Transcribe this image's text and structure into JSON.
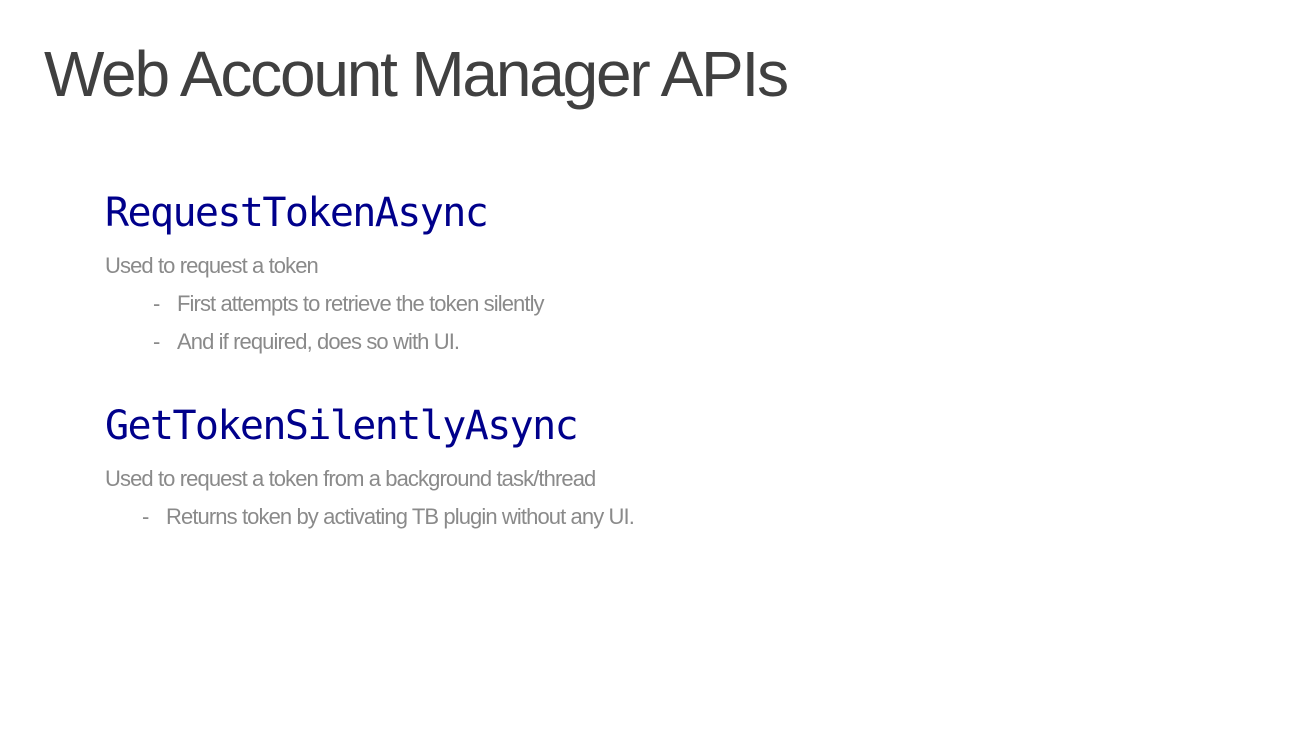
{
  "slide": {
    "title": "Web Account Manager APIs",
    "apis": [
      {
        "name": "RequestTokenAsync",
        "description": "Used to request a token",
        "bullets": [
          {
            "dash": "-",
            "text": "First attempts to retrieve the token silently"
          },
          {
            "dash": "-",
            "text": "And if required, does so with UI."
          }
        ]
      },
      {
        "name": "GetTokenSilentlyAsync",
        "description": "Used to request a token from a background task/thread",
        "bullets": [
          {
            "dash": "-",
            "text": "Returns token by activating TB plugin without any UI."
          }
        ]
      }
    ],
    "colors": {
      "title": "#404040",
      "api_name": "#00008b",
      "body_text": "#8a8a8a",
      "background": "#ffffff"
    }
  }
}
